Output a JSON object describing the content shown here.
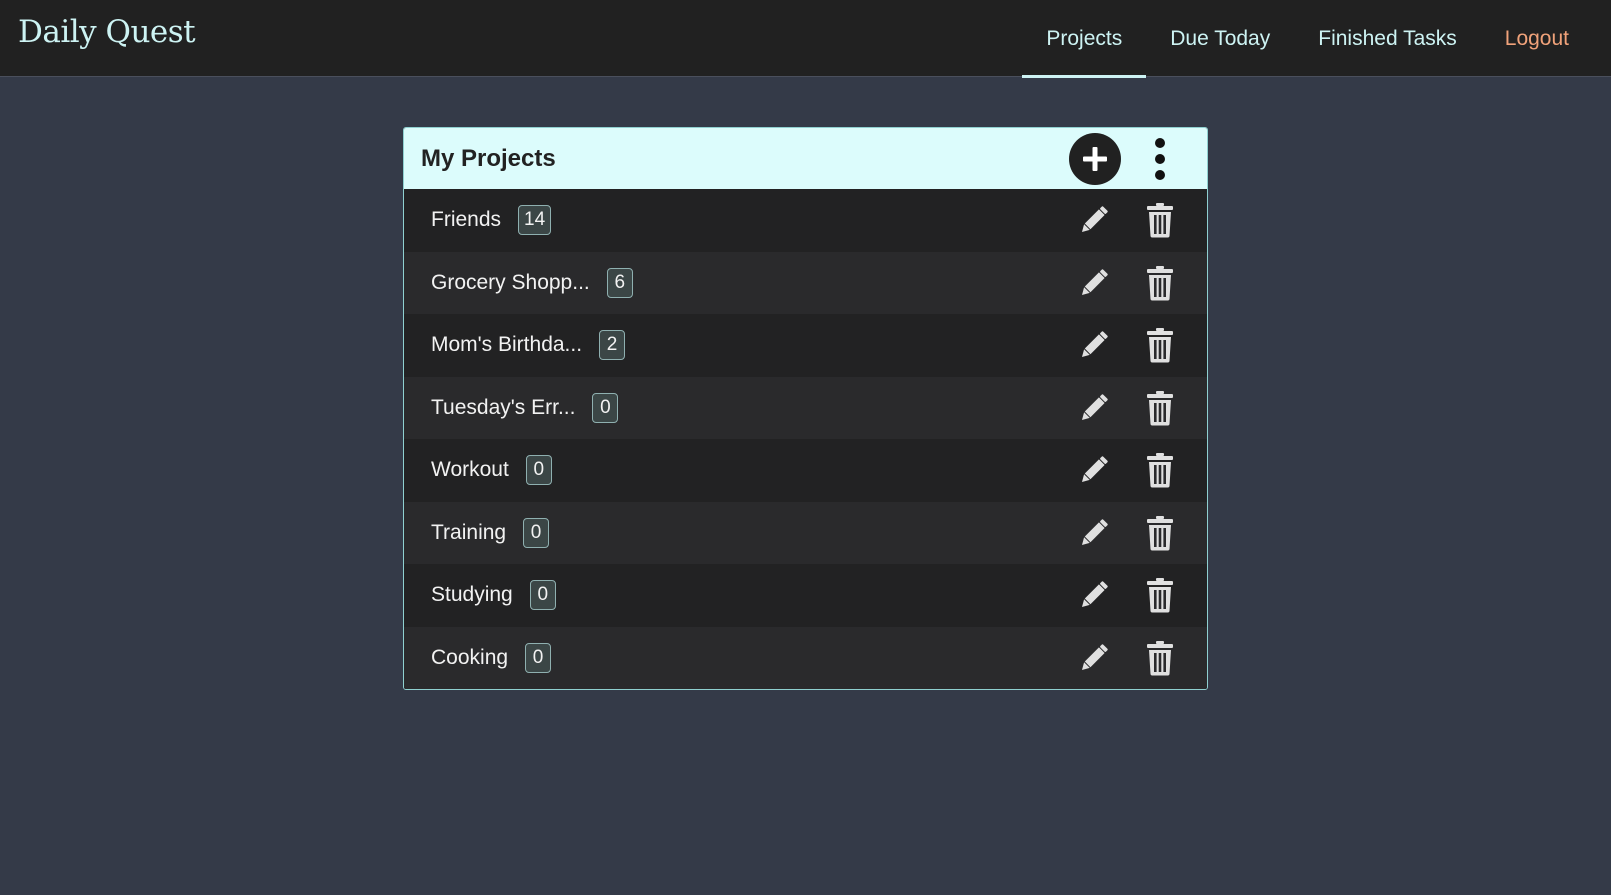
{
  "app": {
    "title": "Daily Quest"
  },
  "nav": {
    "items": [
      {
        "label": "Projects",
        "active": true
      },
      {
        "label": "Due Today"
      },
      {
        "label": "Finished Tasks"
      },
      {
        "label": "Logout"
      }
    ]
  },
  "projects_card": {
    "title": "My Projects",
    "add_icon": "plus-icon",
    "menu_icon": "vertical-dots-icon",
    "edit_icon": "pencil-icon",
    "delete_icon": "trash-icon",
    "items": [
      {
        "name": "Friends",
        "count": "14"
      },
      {
        "name": "Grocery Shopp...",
        "count": "6"
      },
      {
        "name": "Mom's Birthda...",
        "count": "2"
      },
      {
        "name": "Tuesday's Err...",
        "count": "0"
      },
      {
        "name": "Workout",
        "count": "0"
      },
      {
        "name": "Training",
        "count": "0"
      },
      {
        "name": "Studying",
        "count": "0"
      },
      {
        "name": "Cooking",
        "count": "0"
      }
    ]
  },
  "colors": {
    "page_background": "#343a48",
    "navbar_background": "#212121",
    "brand_text": "#cdf3f3",
    "logout_text": "#f0a27a",
    "card_header_background": "#dcfcfc"
  }
}
